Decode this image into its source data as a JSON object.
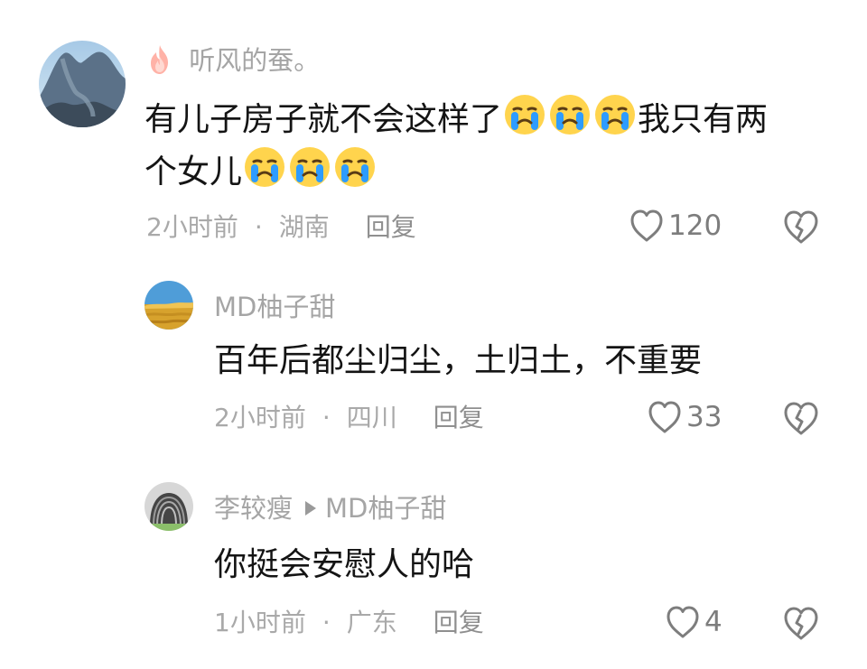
{
  "comments": [
    {
      "author": "听风的蚕。",
      "content_parts": [
        "有儿子房子就不会这样了",
        "我只有两",
        "个女儿"
      ],
      "emoji_name": "crying-face-icon",
      "time": "2小时前",
      "location": "湖南",
      "reply_label": "回复",
      "likes": "120",
      "has_flame_badge": true
    },
    {
      "author": "MD柚子甜",
      "content": "百年后都尘归尘，土归土，不重要",
      "time": "2小时前",
      "location": "四川",
      "reply_label": "回复",
      "likes": "33"
    },
    {
      "author": "李较瘦",
      "reply_to": "MD柚子甜",
      "content": "你挺会安慰人的哈",
      "time": "1小时前",
      "location": "广东",
      "reply_label": "回复",
      "likes": "4"
    }
  ],
  "separator_dot": "·",
  "colors": {
    "name_gray": "#a5a5a5",
    "text_black": "#141414",
    "meta_gray": "#a9a9a9",
    "icon_gray": "#7d7d7d",
    "emoji_yellow": "#ffd44d",
    "emoji_tears": "#2d9cff"
  }
}
